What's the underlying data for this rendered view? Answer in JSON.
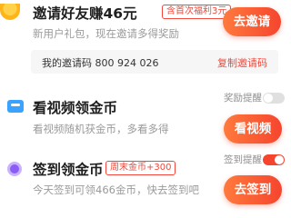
{
  "invite": {
    "title": "邀请好友赚46元",
    "tag": "含首次福利3元",
    "desc": "新用户礼包，现在邀请多得奖励",
    "button": "去邀请",
    "code_label": "我的邀请码 800 924 026",
    "copy_label": "复制邀请码",
    "icon": "gift-bag-icon"
  },
  "video": {
    "title": "看视频领金币",
    "desc": "看视频随机获金币，多看多得",
    "toggle_label": "奖励提醒",
    "toggle_on": false,
    "button": "看视频",
    "icon": "tv-icon"
  },
  "signin": {
    "title": "签到领金币",
    "tag": "周末金币+300",
    "desc": "今天签到可领466金币，快去签到吧",
    "toggle_label": "签到提醒",
    "toggle_on": true,
    "button": "去签到",
    "icon": "coin-icon"
  },
  "colors": {
    "accent": "#f5452e",
    "toggle_off": "#e0e0e0"
  }
}
